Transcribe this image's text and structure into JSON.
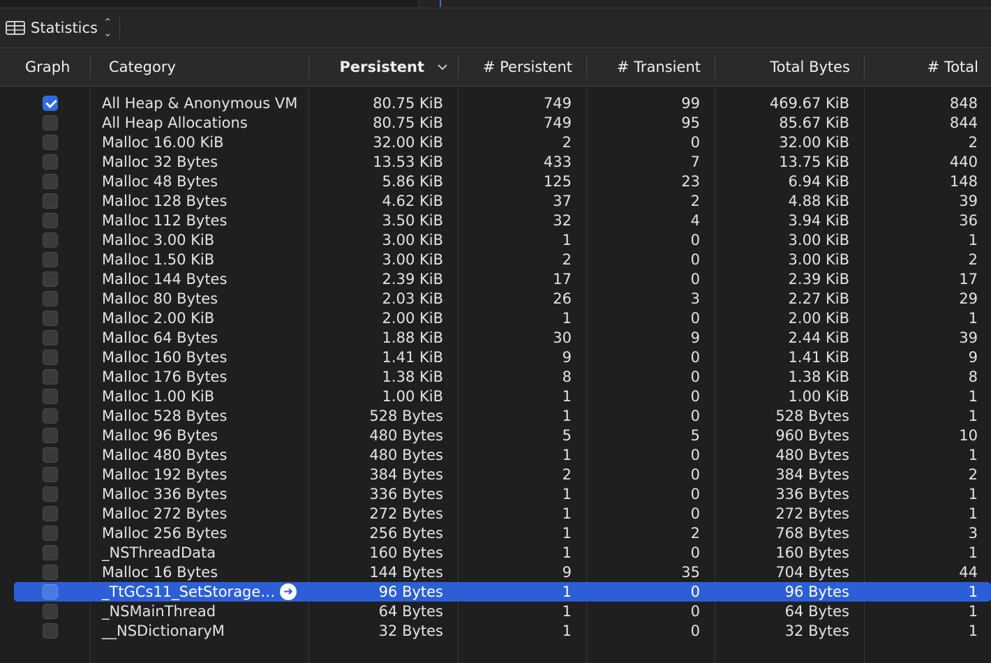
{
  "toolbar": {
    "view_label": "Statistics",
    "view_icon": "table-icon",
    "updown_icon": "up-down-chevron-icon"
  },
  "columns": {
    "graph": "Graph",
    "category": "Category",
    "persistent": "Persistent",
    "num_persistent": "# Persistent",
    "num_transient": "# Transient",
    "total_bytes": "Total Bytes",
    "num_total": "# Total"
  },
  "sort": {
    "column": "persistent",
    "direction": "descending"
  },
  "colors": {
    "accent": "#2f6bdf",
    "selection": "#2c5fd5",
    "background": "#1f1f1f"
  },
  "rows": [
    {
      "checked": true,
      "category": "All Heap & Anonymous VM",
      "persistent": "80.75 KiB",
      "num_persistent": "749",
      "num_transient": "99",
      "total_bytes": "469.67 KiB",
      "num_total": "848"
    },
    {
      "checked": false,
      "category": "All Heap Allocations",
      "persistent": "80.75 KiB",
      "num_persistent": "749",
      "num_transient": "95",
      "total_bytes": "85.67 KiB",
      "num_total": "844"
    },
    {
      "checked": false,
      "category": "Malloc 16.00 KiB",
      "persistent": "32.00 KiB",
      "num_persistent": "2",
      "num_transient": "0",
      "total_bytes": "32.00 KiB",
      "num_total": "2"
    },
    {
      "checked": false,
      "category": "Malloc 32 Bytes",
      "persistent": "13.53 KiB",
      "num_persistent": "433",
      "num_transient": "7",
      "total_bytes": "13.75 KiB",
      "num_total": "440"
    },
    {
      "checked": false,
      "category": "Malloc 48 Bytes",
      "persistent": "5.86 KiB",
      "num_persistent": "125",
      "num_transient": "23",
      "total_bytes": "6.94 KiB",
      "num_total": "148"
    },
    {
      "checked": false,
      "category": "Malloc 128 Bytes",
      "persistent": "4.62 KiB",
      "num_persistent": "37",
      "num_transient": "2",
      "total_bytes": "4.88 KiB",
      "num_total": "39"
    },
    {
      "checked": false,
      "category": "Malloc 112 Bytes",
      "persistent": "3.50 KiB",
      "num_persistent": "32",
      "num_transient": "4",
      "total_bytes": "3.94 KiB",
      "num_total": "36"
    },
    {
      "checked": false,
      "category": "Malloc 3.00 KiB",
      "persistent": "3.00 KiB",
      "num_persistent": "1",
      "num_transient": "0",
      "total_bytes": "3.00 KiB",
      "num_total": "1"
    },
    {
      "checked": false,
      "category": "Malloc 1.50 KiB",
      "persistent": "3.00 KiB",
      "num_persistent": "2",
      "num_transient": "0",
      "total_bytes": "3.00 KiB",
      "num_total": "2"
    },
    {
      "checked": false,
      "category": "Malloc 144 Bytes",
      "persistent": "2.39 KiB",
      "num_persistent": "17",
      "num_transient": "0",
      "total_bytes": "2.39 KiB",
      "num_total": "17"
    },
    {
      "checked": false,
      "category": "Malloc 80 Bytes",
      "persistent": "2.03 KiB",
      "num_persistent": "26",
      "num_transient": "3",
      "total_bytes": "2.27 KiB",
      "num_total": "29"
    },
    {
      "checked": false,
      "category": "Malloc 2.00 KiB",
      "persistent": "2.00 KiB",
      "num_persistent": "1",
      "num_transient": "0",
      "total_bytes": "2.00 KiB",
      "num_total": "1"
    },
    {
      "checked": false,
      "category": "Malloc 64 Bytes",
      "persistent": "1.88 KiB",
      "num_persistent": "30",
      "num_transient": "9",
      "total_bytes": "2.44 KiB",
      "num_total": "39"
    },
    {
      "checked": false,
      "category": "Malloc 160 Bytes",
      "persistent": "1.41 KiB",
      "num_persistent": "9",
      "num_transient": "0",
      "total_bytes": "1.41 KiB",
      "num_total": "9"
    },
    {
      "checked": false,
      "category": "Malloc 176 Bytes",
      "persistent": "1.38 KiB",
      "num_persistent": "8",
      "num_transient": "0",
      "total_bytes": "1.38 KiB",
      "num_total": "8"
    },
    {
      "checked": false,
      "category": "Malloc 1.00 KiB",
      "persistent": "1.00 KiB",
      "num_persistent": "1",
      "num_transient": "0",
      "total_bytes": "1.00 KiB",
      "num_total": "1"
    },
    {
      "checked": false,
      "category": "Malloc 528 Bytes",
      "persistent": "528 Bytes",
      "num_persistent": "1",
      "num_transient": "0",
      "total_bytes": "528 Bytes",
      "num_total": "1"
    },
    {
      "checked": false,
      "category": "Malloc 96 Bytes",
      "persistent": "480 Bytes",
      "num_persistent": "5",
      "num_transient": "5",
      "total_bytes": "960 Bytes",
      "num_total": "10"
    },
    {
      "checked": false,
      "category": "Malloc 480 Bytes",
      "persistent": "480 Bytes",
      "num_persistent": "1",
      "num_transient": "0",
      "total_bytes": "480 Bytes",
      "num_total": "1"
    },
    {
      "checked": false,
      "category": "Malloc 192 Bytes",
      "persistent": "384 Bytes",
      "num_persistent": "2",
      "num_transient": "0",
      "total_bytes": "384 Bytes",
      "num_total": "2"
    },
    {
      "checked": false,
      "category": "Malloc 336 Bytes",
      "persistent": "336 Bytes",
      "num_persistent": "1",
      "num_transient": "0",
      "total_bytes": "336 Bytes",
      "num_total": "1"
    },
    {
      "checked": false,
      "category": "Malloc 272 Bytes",
      "persistent": "272 Bytes",
      "num_persistent": "1",
      "num_transient": "0",
      "total_bytes": "272 Bytes",
      "num_total": "1"
    },
    {
      "checked": false,
      "category": "Malloc 256 Bytes",
      "persistent": "256 Bytes",
      "num_persistent": "1",
      "num_transient": "2",
      "total_bytes": "768 Bytes",
      "num_total": "3"
    },
    {
      "checked": false,
      "category": "_NSThreadData",
      "persistent": "160 Bytes",
      "num_persistent": "1",
      "num_transient": "0",
      "total_bytes": "160 Bytes",
      "num_total": "1"
    },
    {
      "checked": false,
      "category": "Malloc 16 Bytes",
      "persistent": "144 Bytes",
      "num_persistent": "9",
      "num_transient": "35",
      "total_bytes": "704 Bytes",
      "num_total": "44"
    },
    {
      "checked": false,
      "selected": true,
      "category": "_TtGCs11_SetStorage…",
      "persistent": "96 Bytes",
      "num_persistent": "1",
      "num_transient": "0",
      "total_bytes": "96 Bytes",
      "num_total": "1"
    },
    {
      "checked": false,
      "category": "_NSMainThread",
      "persistent": "64 Bytes",
      "num_persistent": "1",
      "num_transient": "0",
      "total_bytes": "64 Bytes",
      "num_total": "1"
    },
    {
      "checked": false,
      "category": "__NSDictionaryM",
      "persistent": "32 Bytes",
      "num_persistent": "1",
      "num_transient": "0",
      "total_bytes": "32 Bytes",
      "num_total": "1"
    }
  ]
}
